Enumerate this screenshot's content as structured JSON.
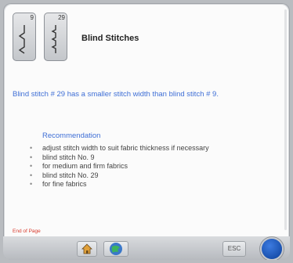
{
  "header": {
    "stitch_a": {
      "number": "9",
      "icon": "blind-stitch-9-icon"
    },
    "stitch_b": {
      "number": "29",
      "icon": "blind-stitch-29-icon"
    },
    "title": "Blind Stitches"
  },
  "content": {
    "intro": "Blind stitch # 29 has a smaller stitch width than blind stitch # 9.",
    "recommendation_heading": "Recommendation",
    "recommendations": [
      "adjust stitch width to suit fabric thickness if necessary",
      "blind stitch No. 9",
      "for medium and firm fabrics",
      "blind stitch No. 29",
      "for fine fabrics"
    ],
    "end_of_page": "End of Page"
  },
  "taskbar": {
    "btn1": "",
    "btn2": "",
    "home_icon": "home-icon",
    "tutorial_icon": "globe-icon",
    "esc_label": "ESC",
    "round_icon": "blue-round-button"
  },
  "colors": {
    "accent_blue": "#3f6fd6",
    "end_of_page": "#d83a2c",
    "round_button": "#0a3f9a"
  }
}
